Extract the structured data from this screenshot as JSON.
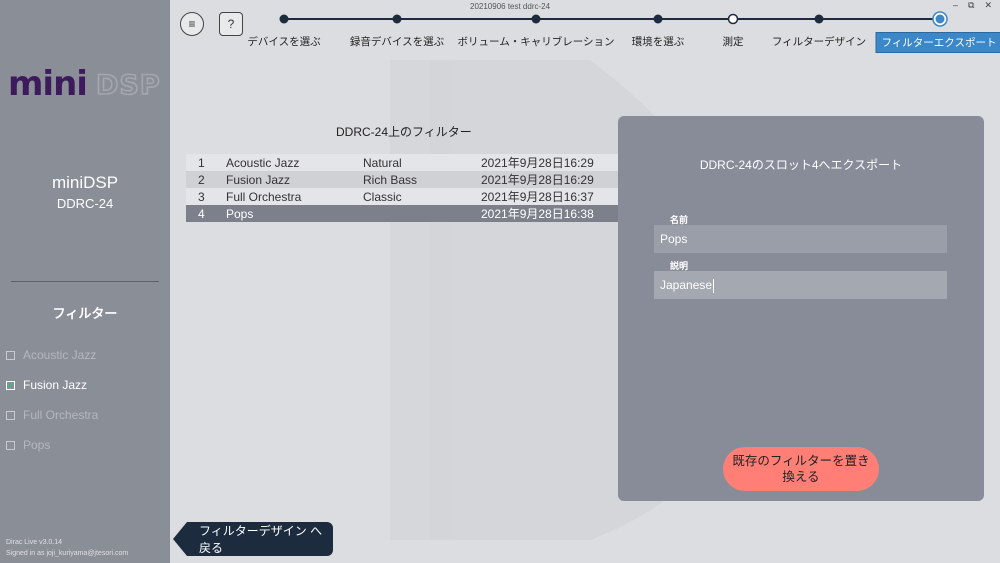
{
  "window": {
    "title": "20210906 test ddrc-24",
    "controls": [
      "–",
      "⧉",
      "✕"
    ]
  },
  "toolbar": {
    "menu_icon": "≡",
    "help_label": "?"
  },
  "steps": [
    {
      "label": "デバイスを選ぶ",
      "state": "done"
    },
    {
      "label": "録音デバイスを選ぶ",
      "state": "done"
    },
    {
      "label": "ボリューム・キャリブレーション",
      "state": "done"
    },
    {
      "label": "環境を選ぶ",
      "state": "done"
    },
    {
      "label": "測定",
      "state": "pending"
    },
    {
      "label": "フィルターデザイン",
      "state": "done"
    },
    {
      "label": "フィルターエクスポート",
      "state": "active"
    }
  ],
  "sidebar": {
    "logo_left": "mini",
    "logo_right": "DSP",
    "device_name": "miniDSP",
    "device_model": "DDRC-24",
    "filters_title": "フィルター",
    "items": [
      {
        "label": "Acoustic Jazz",
        "checked": false
      },
      {
        "label": "Fusion Jazz",
        "checked": true
      },
      {
        "label": "Full Orchestra",
        "checked": false
      },
      {
        "label": "Pops",
        "checked": false
      }
    ],
    "version": "Dirac Live v3.0.14",
    "signed_in": "Signed in as joji_kuriyama@jtesori.com"
  },
  "filter_list": {
    "title": "DDRC-24上のフィルター",
    "rows": [
      {
        "num": "1",
        "name": "Acoustic Jazz",
        "type": "Natural",
        "date": "2021年9月28日16:29"
      },
      {
        "num": "2",
        "name": "Fusion Jazz",
        "type": "Rich Bass",
        "date": "2021年9月28日16:29"
      },
      {
        "num": "3",
        "name": "Full Orchestra",
        "type": "Classic",
        "date": "2021年9月28日16:37"
      },
      {
        "num": "4",
        "name": "Pops",
        "type": "",
        "date": "2021年9月28日16:38"
      }
    ],
    "selected_index": 3
  },
  "export_panel": {
    "title": "DDRC-24のスロット4へエクスポート",
    "name_label": "名前",
    "name_value": "Pops",
    "desc_label": "説明",
    "desc_value": "Japanese",
    "replace_button_line1": "既存のフィルターを置き",
    "replace_button_line2": "換える"
  },
  "back_button": "フィルターデザイン へ戻る",
  "colors": {
    "accent": "#3b87c7",
    "sidebar": "#8a8e97",
    "panel": "#878c98",
    "replace_button": "#ff7f77",
    "back_button": "#1c2b3e",
    "check": "#2bbf8a"
  }
}
